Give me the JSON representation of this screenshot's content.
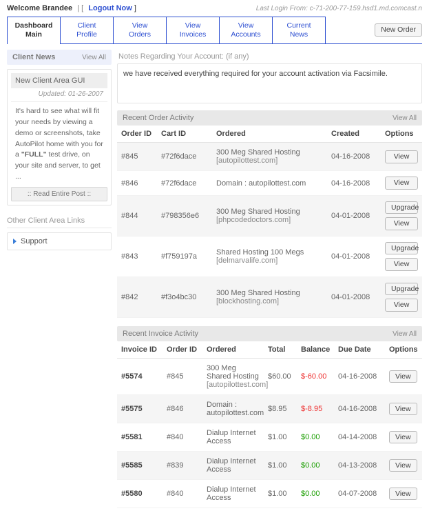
{
  "header": {
    "welcome_prefix": "Welcome ",
    "user_name": "Brandee",
    "welcome_suffix": " | [ ",
    "logout_label": "Logout Now",
    "welcome_end": " ]",
    "last_login": "Last Login From: c-71-200-77-159.hsd1.md.comcast.n"
  },
  "tabs": {
    "0": {
      "l1": "Dashboard",
      "l2": "Main"
    },
    "1": {
      "l1": "Client",
      "l2": "Profile"
    },
    "2": {
      "l1": "View",
      "l2": "Orders"
    },
    "3": {
      "l1": "View",
      "l2": "Invoices"
    },
    "4": {
      "l1": "View",
      "l2": "Accounts"
    },
    "5": {
      "l1": "Current",
      "l2": "News"
    },
    "new_order": "New Order"
  },
  "side": {
    "client_news_head": "Client News",
    "view_all": "View All",
    "news_title": "New Client Area GUI",
    "updated_label": "Updated: 01-26-2007",
    "news_body_1": "It's hard to see what will fit your needs by viewing a demo or screenshots, take AutoPilot home with you for a ",
    "news_body_bold": "\"FULL\"",
    "news_body_2": " test drive, on your site and server, to get ...",
    "read_post": ":: Read Entire Post ::",
    "other_links": "Other Client Area Links",
    "support": "Support"
  },
  "notes": {
    "label": "Notes Regarding Your Account: (if any)",
    "text": "we have received everything required for your account activation via Facsimile."
  },
  "orders": {
    "section_title": "Recent Order Activity",
    "view_all": "View All",
    "th": {
      "order_id": "Order ID",
      "cart_id": "Cart ID",
      "ordered": "Ordered",
      "created": "Created",
      "options": "Options"
    },
    "btn_view": "View",
    "btn_upgrade": "Upgrade",
    "rows": {
      "0": {
        "order_id": "#845",
        "cart_id": "#72f6dace",
        "desc": "300 Meg Shared Hosting",
        "dom": "[autopilottest.com]",
        "created": "04-16-2008",
        "has_upgrade": false
      },
      "1": {
        "order_id": "#846",
        "cart_id": "#72f6dace",
        "desc": "Domain : autopilottest.com",
        "dom": "",
        "created": "04-16-2008",
        "has_upgrade": false
      },
      "2": {
        "order_id": "#844",
        "cart_id": "#798356e6",
        "desc": "300 Meg Shared Hosting",
        "dom": "[phpcodedoctors.com]",
        "created": "04-01-2008",
        "has_upgrade": true
      },
      "3": {
        "order_id": "#843",
        "cart_id": "#f759197a",
        "desc": "Shared Hosting 100 Megs",
        "dom": "[delmarvalife.com]",
        "created": "04-01-2008",
        "has_upgrade": true
      },
      "4": {
        "order_id": "#842",
        "cart_id": "#f3o4bc30",
        "desc": "300 Meg Shared Hosting",
        "dom": "[blockhosting.com]",
        "created": "04-01-2008",
        "has_upgrade": true
      }
    }
  },
  "invoices": {
    "section_title": "Recent Invoice Activity",
    "view_all": "View All",
    "th": {
      "invoice_id": "Invoice ID",
      "order_id": "Order ID",
      "ordered": "Ordered",
      "total": "Total",
      "balance": "Balance",
      "due": "Due Date",
      "options": "Options"
    },
    "btn_view": "View",
    "rows": {
      "0": {
        "invoice_id": "#5574",
        "order_id": "#845",
        "desc": "300 Meg Shared Hosting",
        "dom": "[autopilottest.com]",
        "total": "$60.00",
        "balance": "$-60.00",
        "bal_neg": true,
        "due": "04-16-2008"
      },
      "1": {
        "invoice_id": "#5575",
        "order_id": "#846",
        "desc": "Domain : autopilottest.com",
        "dom": "",
        "total": "$8.95",
        "balance": "$-8.95",
        "bal_neg": true,
        "due": "04-16-2008"
      },
      "2": {
        "invoice_id": "#5581",
        "order_id": "#840",
        "desc": "Dialup Internet Access",
        "dom": "",
        "total": "$1.00",
        "balance": "$0.00",
        "bal_neg": false,
        "due": "04-14-2008"
      },
      "3": {
        "invoice_id": "#5585",
        "order_id": "#839",
        "desc": "Dialup Internet Access",
        "dom": "",
        "total": "$1.00",
        "balance": "$0.00",
        "bal_neg": false,
        "due": "04-13-2008"
      },
      "4": {
        "invoice_id": "#5580",
        "order_id": "#840",
        "desc": "Dialup Internet Access",
        "dom": "",
        "total": "$1.00",
        "balance": "$0.00",
        "bal_neg": false,
        "due": "04-07-2008"
      }
    }
  }
}
